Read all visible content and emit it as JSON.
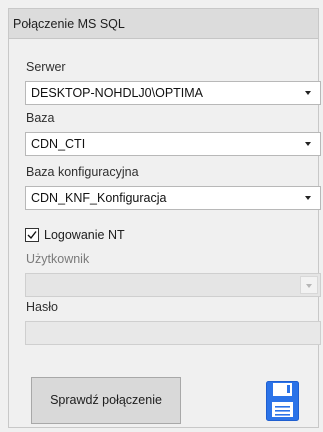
{
  "panel": {
    "title": "Połączenie MS SQL"
  },
  "server": {
    "label": "Serwer",
    "value": "DESKTOP-NOHDLJ0\\OPTIMA"
  },
  "database": {
    "label": "Baza",
    "value": "CDN_CTI"
  },
  "config_database": {
    "label": "Baza konfiguracyjna",
    "value": "CDN_KNF_Konfiguracja"
  },
  "nt_login": {
    "label": "Logowanie NT",
    "checked": true
  },
  "user": {
    "label": "Użytkownik",
    "value": "",
    "enabled": false
  },
  "password": {
    "label": "Hasło",
    "value": "",
    "enabled": false
  },
  "actions": {
    "test_connection_label": "Sprawdź połączenie",
    "save_icon": "floppy-disk-icon"
  },
  "colors": {
    "header_bg": "#dcdcdc",
    "save_icon": "#2b73e8",
    "panel_bg": "#f0f0f0"
  }
}
